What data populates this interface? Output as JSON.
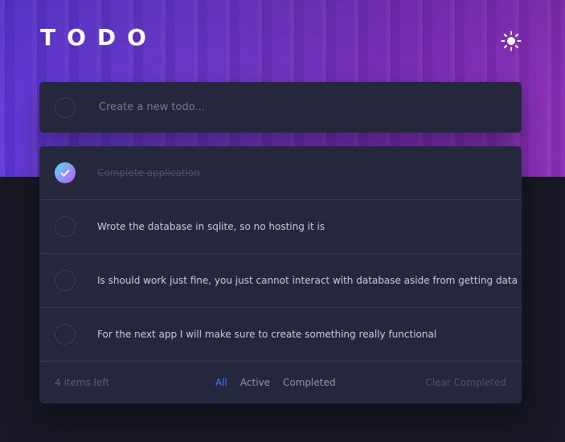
{
  "app": {
    "title": "TODO"
  },
  "theme_toggle": {
    "icon": "sun-icon"
  },
  "new_todo": {
    "placeholder": "Create a new todo..."
  },
  "todos": [
    {
      "text": "Complete application",
      "completed": true
    },
    {
      "text": "Wrote the database in sqlite, so no hosting it is",
      "completed": false
    },
    {
      "text": "Is should work just fine, you just cannot interact with database aside from getting data",
      "completed": false
    },
    {
      "text": "For the next app I will make sure to create something really functional",
      "completed": false
    }
  ],
  "footer": {
    "items_left": "4 items left",
    "filters": [
      "All",
      "Active",
      "Completed"
    ],
    "active_filter": "All",
    "clear_label": "Clear Completed"
  },
  "colors": {
    "accent": "#3a7cfd",
    "check_gradient_start": "#55ddff",
    "check_gradient_end": "#c058f3",
    "card": "#25273d",
    "background": "#171823"
  }
}
